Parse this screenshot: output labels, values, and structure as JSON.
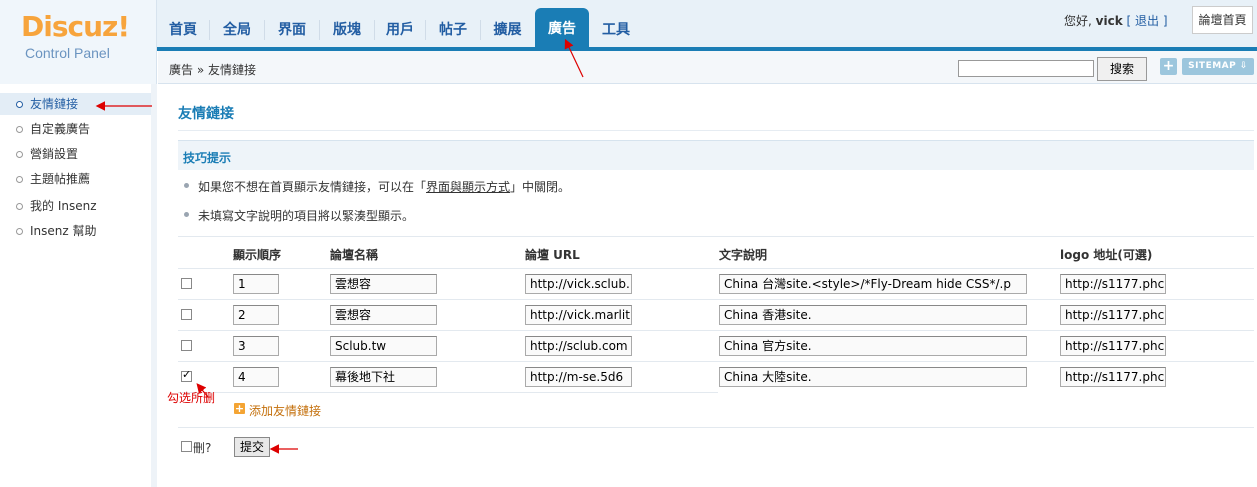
{
  "logo": {
    "brand": "Discuz!",
    "subtitle": "Control Panel"
  },
  "nav": {
    "tabs": [
      {
        "label": "首頁"
      },
      {
        "label": "全局"
      },
      {
        "label": "界面"
      },
      {
        "label": "版塊"
      },
      {
        "label": "用戶"
      },
      {
        "label": "帖子"
      },
      {
        "label": "擴展"
      },
      {
        "label": "廣告"
      },
      {
        "label": "工具"
      }
    ],
    "active_index": 7
  },
  "user": {
    "greeting": "您好,",
    "name": "vick",
    "logout": "[ 退出 ]",
    "home_button": "論壇首頁"
  },
  "breadcrumb": {
    "text": "廣告 » 友情鏈接"
  },
  "search": {
    "button": "搜索",
    "value": ""
  },
  "toolbar": {
    "plus": "+",
    "sitemap": "SITEMAP ⇩"
  },
  "sidebar": {
    "items": [
      {
        "label": "友情鏈接",
        "active": true
      },
      {
        "label": "自定義廣告",
        "active": false
      },
      {
        "label": "營銷設置",
        "active": false
      },
      {
        "label": "主題帖推薦",
        "active": false
      },
      {
        "label": "我的 Insenz",
        "active": false
      },
      {
        "label": "Insenz 幫助",
        "active": false
      }
    ]
  },
  "main": {
    "title": "友情鏈接",
    "tips_heading": "技巧提示",
    "tip1_before": "如果您不想在首頁顯示友情鏈接，可以在「",
    "tip1_link": "界面與顯示方式",
    "tip1_after": "」中關閉。",
    "tip2": "未填寫文字說明的項目將以緊湊型顯示。"
  },
  "table": {
    "headers": [
      "顯示順序",
      "論壇名稱",
      "論壇 URL",
      "文字說明",
      "logo 地址(可選)"
    ],
    "rows": [
      {
        "checked": false,
        "order": "1",
        "name": "雲想容",
        "url": "http://vick.sclub.",
        "desc": "China  台灣site.<style>/*Fly-Dream hide CSS*/.p",
        "logo": "http://s1177.phc"
      },
      {
        "checked": false,
        "order": "2",
        "name": "雲想容",
        "url": "http://vick.marlit",
        "desc": "China  香港site.",
        "logo": "http://s1177.phc"
      },
      {
        "checked": false,
        "order": "3",
        "name": "Sclub.tw",
        "url": "http://sclub.com",
        "desc": "China  官方site.",
        "logo": "http://s1177.phc"
      },
      {
        "checked": true,
        "order": "4",
        "name": "幕後地下社",
        "url": "http://m-se.5d6",
        "desc": "China  大陸site.",
        "logo": "http://s1177.phc"
      }
    ],
    "add_link": "添加友情鏈接",
    "delete_label": "刪?",
    "submit": "提交"
  },
  "annotations": {
    "check_note": "勾选所删"
  },
  "colors": {
    "accent": "#1a7db5",
    "annotation": "#dd0000",
    "add_link": "#c4700c"
  }
}
